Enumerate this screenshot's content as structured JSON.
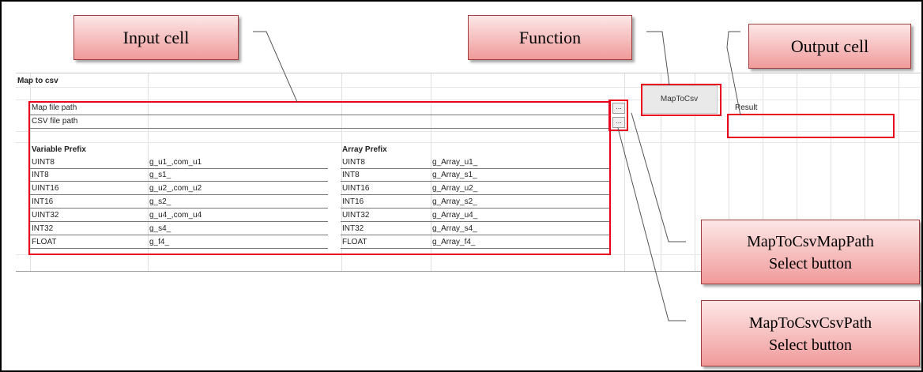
{
  "sheet": {
    "title": "Map to csv",
    "map_file_label": "Map file path",
    "csv_file_label": "CSV file path",
    "browse_label": "...",
    "function_button": "MapToCsv",
    "result_label": "Result",
    "variable_header": "Variable Prefix",
    "array_header": "Array Prefix",
    "variable_rows": [
      {
        "type": "UINT8",
        "prefix": "g_u1_,com_u1"
      },
      {
        "type": "INT8",
        "prefix": "g_s1_"
      },
      {
        "type": "UINT16",
        "prefix": "g_u2_,com_u2"
      },
      {
        "type": "INT16",
        "prefix": "g_s2_"
      },
      {
        "type": "UINT32",
        "prefix": "g_u4_,com_u4"
      },
      {
        "type": "INT32",
        "prefix": "g_s4_"
      },
      {
        "type": "FLOAT",
        "prefix": "g_f4_"
      }
    ],
    "array_rows": [
      {
        "type": "UINT8",
        "prefix": "g_Array_u1_"
      },
      {
        "type": "INT8",
        "prefix": "g_Array_s1_"
      },
      {
        "type": "UINT16",
        "prefix": "g_Array_u2_"
      },
      {
        "type": "INT16",
        "prefix": "g_Array_s2_"
      },
      {
        "type": "UINT32",
        "prefix": "g_Array_u4_"
      },
      {
        "type": "INT32",
        "prefix": "g_Array_s4_"
      },
      {
        "type": "FLOAT",
        "prefix": "g_Array_f4_"
      }
    ]
  },
  "callouts": {
    "input_cell": "Input cell",
    "function": "Function",
    "output_cell": "Output cell",
    "map_path_line1": "MapToCsvMapPath",
    "map_path_line2": "Select button",
    "csv_path_line1": "MapToCsvCsvPath",
    "csv_path_line2": "Select button"
  },
  "colors": {
    "highlight": "#e8001c",
    "callout_fill": "#f09a9a"
  }
}
